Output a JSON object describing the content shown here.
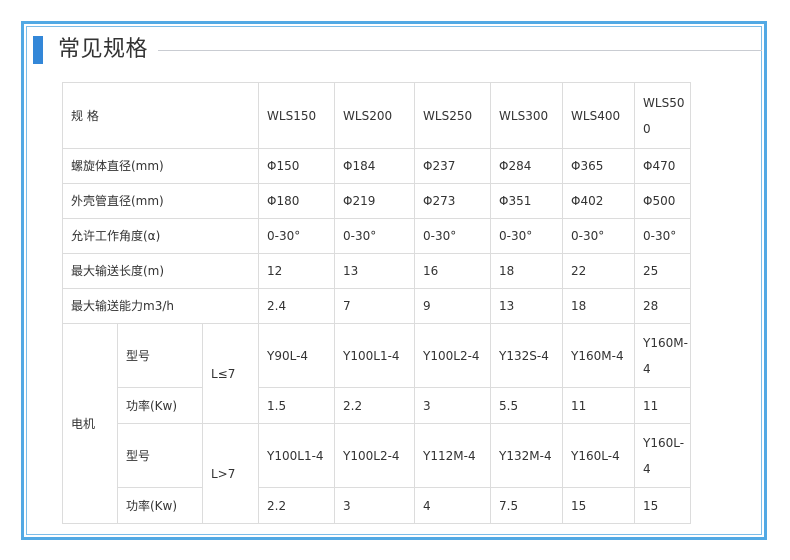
{
  "section_title": "常见规格",
  "spec_table": {
    "header": {
      "label": "规 格",
      "models": [
        "WLS150",
        "WLS200",
        "WLS250",
        "WLS300",
        "WLS400",
        "WLS500"
      ]
    },
    "rows": [
      {
        "label": "螺旋体直径(mm)",
        "values": [
          "Φ150",
          "Φ184",
          "Φ237",
          "Φ284",
          "Φ365",
          "Φ470"
        ]
      },
      {
        "label": "外壳管直径(mm)",
        "values": [
          "Φ180",
          "Φ219",
          "Φ273",
          "Φ351",
          "Φ402",
          "Φ500"
        ]
      },
      {
        "label": "允许工作角度(α)",
        "values": [
          "0-30°",
          "0-30°",
          "0-30°",
          "0-30°",
          "0-30°",
          "0-30°"
        ]
      },
      {
        "label": "最大输送长度(m)",
        "values": [
          "12",
          "13",
          "16",
          "18",
          "22",
          "25"
        ]
      },
      {
        "label": "最大输送能力m3/h",
        "values": [
          "2.4",
          "7",
          "9",
          "13",
          "18",
          "28"
        ]
      }
    ],
    "motor": {
      "label": "电机",
      "groups": [
        {
          "condition": "L≤7",
          "model_label": "型号",
          "models": [
            "Y90L-4",
            "Y100L1-4",
            "Y100L2-4",
            "Y132S-4",
            "Y160M-4",
            "Y160M-4"
          ],
          "power_label": "功率(Kw)",
          "powers": [
            "1.5",
            "2.2",
            "3",
            "5.5",
            "11",
            "11"
          ]
        },
        {
          "condition": "L>7",
          "model_label": "型号",
          "models": [
            "Y100L1-4",
            "Y100L2-4",
            "Y112M-4",
            "Y132M-4",
            "Y160L-4",
            "Y160L-4"
          ],
          "power_label": "功率(Kw)",
          "powers": [
            "2.2",
            "3",
            "4",
            "7.5",
            "15",
            "15"
          ]
        }
      ]
    }
  }
}
